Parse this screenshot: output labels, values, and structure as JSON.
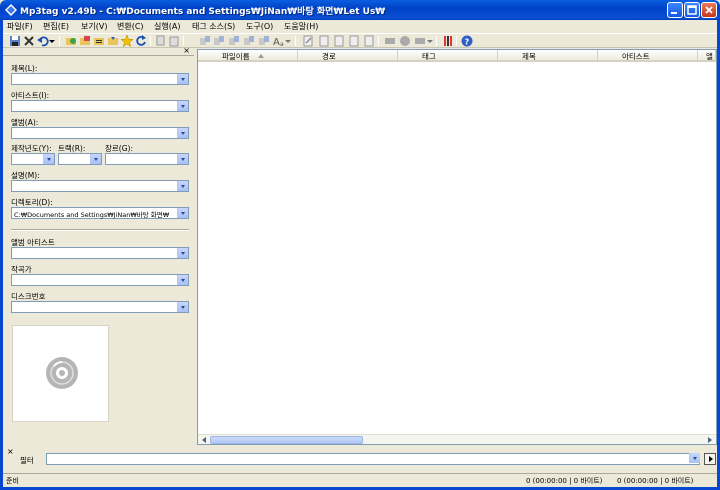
{
  "window": {
    "title": "Mp3tag v2.49b  -  C:₩Documents and Settings₩JiNan₩바탕 화면₩Let Us₩"
  },
  "menu": [
    "파일(F)",
    "편집(E)",
    "보기(V)",
    "변환(C)",
    "실행(A)",
    "태그 소스(S)",
    "도구(O)",
    "도움말(H)"
  ],
  "panel": {
    "title_label": "제목(L):",
    "artist_label": "아티스트(I):",
    "album_label": "앨범(A):",
    "year_label": "제작년도(Y):",
    "track_label": "트랙(R):",
    "genre_label": "장르(G):",
    "comment_label": "설명(M):",
    "directory_label": "디렉토리(D):",
    "directory_value": "C:₩Documents and Settings₩JiNan₩바탕 화면₩",
    "album_artist_label": "앨범 아티스트",
    "composer_label": "작곡가",
    "disc_label": "디스크번호"
  },
  "columns": [
    "파일이름",
    "경로",
    "태그",
    "제목",
    "아티스트",
    "앨"
  ],
  "filter": {
    "label": "필터",
    "value": ""
  },
  "status": {
    "left": "준비",
    "selected": "0 (00:00:00 | 0 바이트)",
    "total": "0 (00:00:00 | 0 바이트)"
  },
  "colors": {
    "titlebar": "#0a5ee0",
    "face": "#ece9d8",
    "border": "#7f9db9"
  }
}
